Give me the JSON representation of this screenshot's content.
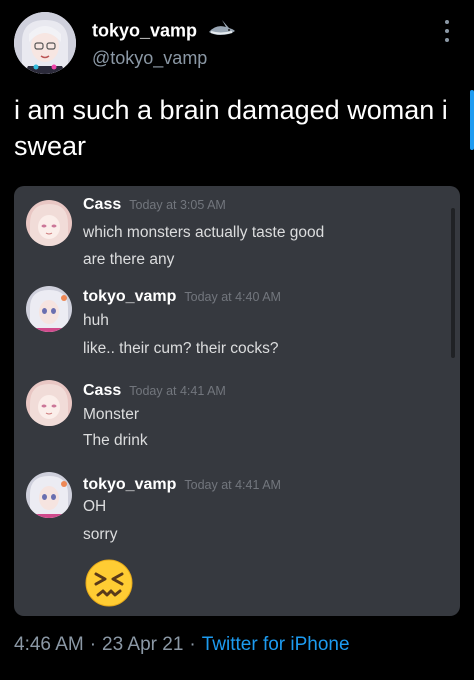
{
  "user": {
    "name": "tokyo_vamp",
    "handle": "@tokyo_vamp",
    "badge_icon": "shark-emoji"
  },
  "tweet_text": "i am such a brain damaged woman i swear",
  "discord": {
    "messages": [
      {
        "author": "Cass",
        "author_color": "#ffffff",
        "time": "Today at 3:05 AM",
        "lines": [
          "which monsters actually taste good",
          "are there any"
        ]
      },
      {
        "author": "tokyo_vamp",
        "author_color": "#ffffff",
        "time": "Today at 4:40 AM",
        "lines": [
          "huh",
          "like.. their cum? their cocks?"
        ]
      },
      {
        "author": "Cass",
        "author_color": "#ffffff",
        "time": "Today at 4:41 AM",
        "lines": [
          "Monster",
          "The drink"
        ]
      },
      {
        "author": "tokyo_vamp",
        "author_color": "#ffffff",
        "time": "Today at 4:41 AM",
        "lines": [
          "OH",
          "sorry"
        ]
      }
    ],
    "reaction_emoji": "confounded-face-emoji"
  },
  "footer": {
    "time": "4:46 AM",
    "date": "23 Apr 21",
    "separator": "·",
    "source": "Twitter for iPhone"
  },
  "colors": {
    "background": "#000000",
    "discord_bg": "#36393f",
    "link": "#1d9bf0",
    "muted": "#8b98a5"
  }
}
